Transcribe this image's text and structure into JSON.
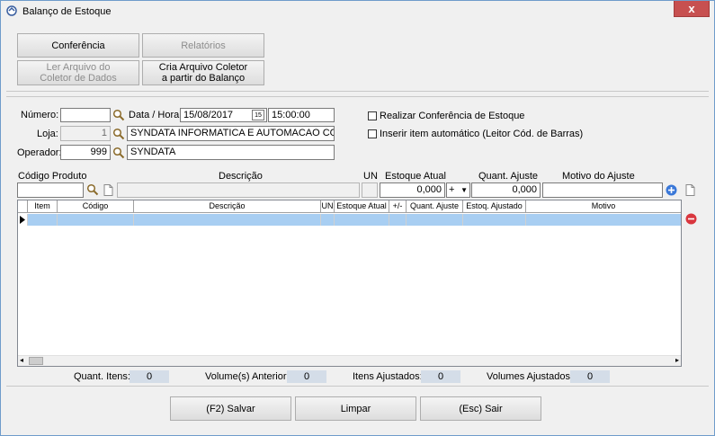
{
  "window": {
    "title": "Balanço de Estoque",
    "close_glyph": "x"
  },
  "toolbar": {
    "conferencia": "Conferência",
    "relatorios": "Relatórios",
    "ler_arquivo_l1": "Ler Arquivo do",
    "ler_arquivo_l2": "Coletor de Dados",
    "cria_arquivo_l1": "Cria Arquivo Coletor",
    "cria_arquivo_l2": "a partir do Balanço"
  },
  "form": {
    "numero_label": "Número:",
    "numero_value": "",
    "data_hora_label": "Data / Hora:",
    "data_value": "15/08/2017",
    "hora_value": "15:00:00",
    "calendar_glyph": "15",
    "loja_label": "Loja:",
    "loja_code": "1",
    "loja_name": "SYNDATA INFORMATICA E AUTOMACAO COME",
    "operador_label": "Operador:",
    "operador_code": "999",
    "operador_name": "SYNDATA",
    "realizar_conferencia": "Realizar Conferência de Estoque",
    "inserir_item": "Inserir item automático (Leitor Cód. de Barras)"
  },
  "entry": {
    "codigo_produto_label": "Código Produto",
    "descricao_label": "Descrição",
    "un_label": "UN",
    "estoque_atual_label": "Estoque Atual",
    "quant_ajuste_label": "Quant. Ajuste",
    "motivo_label": "Motivo do Ajuste",
    "estoque_atual_value": "0,000",
    "sign_value": "+",
    "quant_ajuste_value": "0,000"
  },
  "grid": {
    "columns": [
      "Item",
      "Código",
      "Descrição",
      "UN",
      "Estoque Atual",
      "+/-",
      "Quant. Ajuste",
      "Estoq. Ajustado",
      "Motivo"
    ]
  },
  "totals": {
    "quant_itens_label": "Quant. Itens:",
    "quant_itens_value": "0",
    "volumes_anterior_label": "Volume(s) Anterior:",
    "volumes_anterior_value": "0",
    "itens_ajustados_label": "Itens Ajustados:",
    "itens_ajustados_value": "0",
    "volumes_ajustados_label": "Volumes Ajustados:",
    "volumes_ajustados_value": "0"
  },
  "footer": {
    "salvar": "(F2) Salvar",
    "limpar": "Limpar",
    "sair": "(Esc) Sair"
  },
  "colors": {
    "accent": "#3a78d8",
    "remove": "#d9363e",
    "selected_row": "#a8cef2",
    "close": "#c75050"
  }
}
